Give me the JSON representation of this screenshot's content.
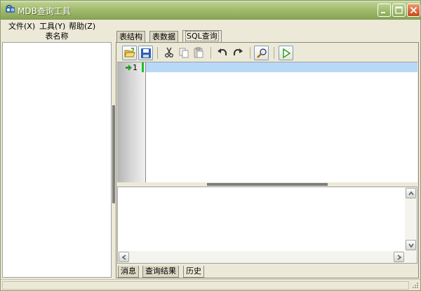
{
  "window": {
    "title": "MDB查询工具"
  },
  "menu": [
    "文件(X)",
    "工具(Y)",
    "帮助(Z)"
  ],
  "left_panel": {
    "header": "表名称",
    "items": []
  },
  "tabs": [
    {
      "label": "表结构",
      "active": false
    },
    {
      "label": "表数据",
      "active": false
    },
    {
      "label": "SQL查询",
      "active": true
    }
  ],
  "toolbar": {
    "items": [
      "open-folder-icon",
      "save-icon",
      "cut-icon",
      "copy-icon",
      "paste-icon",
      "undo-icon",
      "redo-icon",
      "search-icon",
      "run-icon"
    ]
  },
  "editor": {
    "line_numbers": [
      "1"
    ],
    "text": ""
  },
  "bottom_tabs": [
    {
      "label": "消息",
      "active": false
    },
    {
      "label": "查询结果",
      "active": false
    },
    {
      "label": "历史",
      "active": true
    }
  ],
  "colors": {
    "title_bar": "#a4be70",
    "close_button": "#c44a1c",
    "current_line": "#b8d8f8",
    "line_marker": "#22c022",
    "face": "#ece9d8"
  }
}
